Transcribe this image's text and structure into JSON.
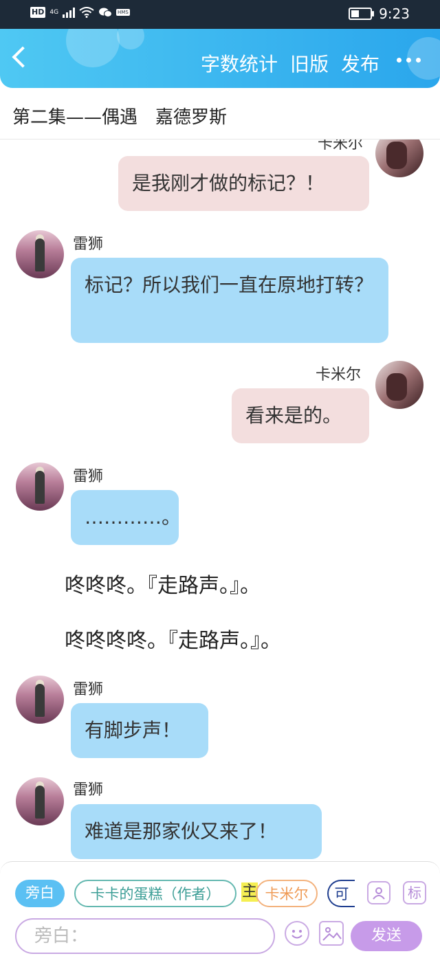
{
  "status_bar": {
    "network": "HD",
    "signal_type": "4G",
    "time": "9:23",
    "battery_level": 0.35
  },
  "header": {
    "back_icon": "chevron-left-icon",
    "menu": [
      "字数统计",
      "旧版",
      "发布"
    ],
    "more_icon": "more-dots-icon",
    "accent": "#2aa6ec"
  },
  "title": "第二集——偶遇　嘉德罗斯",
  "messages": [
    {
      "speaker": "卡米尔",
      "side": "right",
      "text": "是我刚才做的标记？！"
    },
    {
      "speaker": "雷狮",
      "side": "left",
      "text": "标记？所以我们一直在原地打转？"
    },
    {
      "speaker": "卡米尔",
      "side": "right",
      "text": "看来是的。"
    },
    {
      "speaker": "雷狮",
      "side": "left",
      "text": "…………。"
    },
    {
      "narration": "咚咚咚。『走路声。』。"
    },
    {
      "narration": "咚咚咚咚。『走路声。』。"
    },
    {
      "speaker": "雷狮",
      "side": "left",
      "text": "有脚步声！"
    },
    {
      "speaker": "雷狮",
      "side": "left",
      "text": "难道是那家伙又来了！"
    }
  ],
  "bottom": {
    "roles": [
      "旁白",
      "卡卡的蛋糕（作者）",
      "主",
      "卡米尔",
      "可"
    ],
    "tool_icons": [
      "user-card-icon",
      "mark-icon"
    ],
    "tool_mark_label": "标",
    "input_placeholder": "旁白：",
    "emoji_icon": "emoji-icon",
    "image_icon": "image-icon",
    "send_label": "发送"
  }
}
